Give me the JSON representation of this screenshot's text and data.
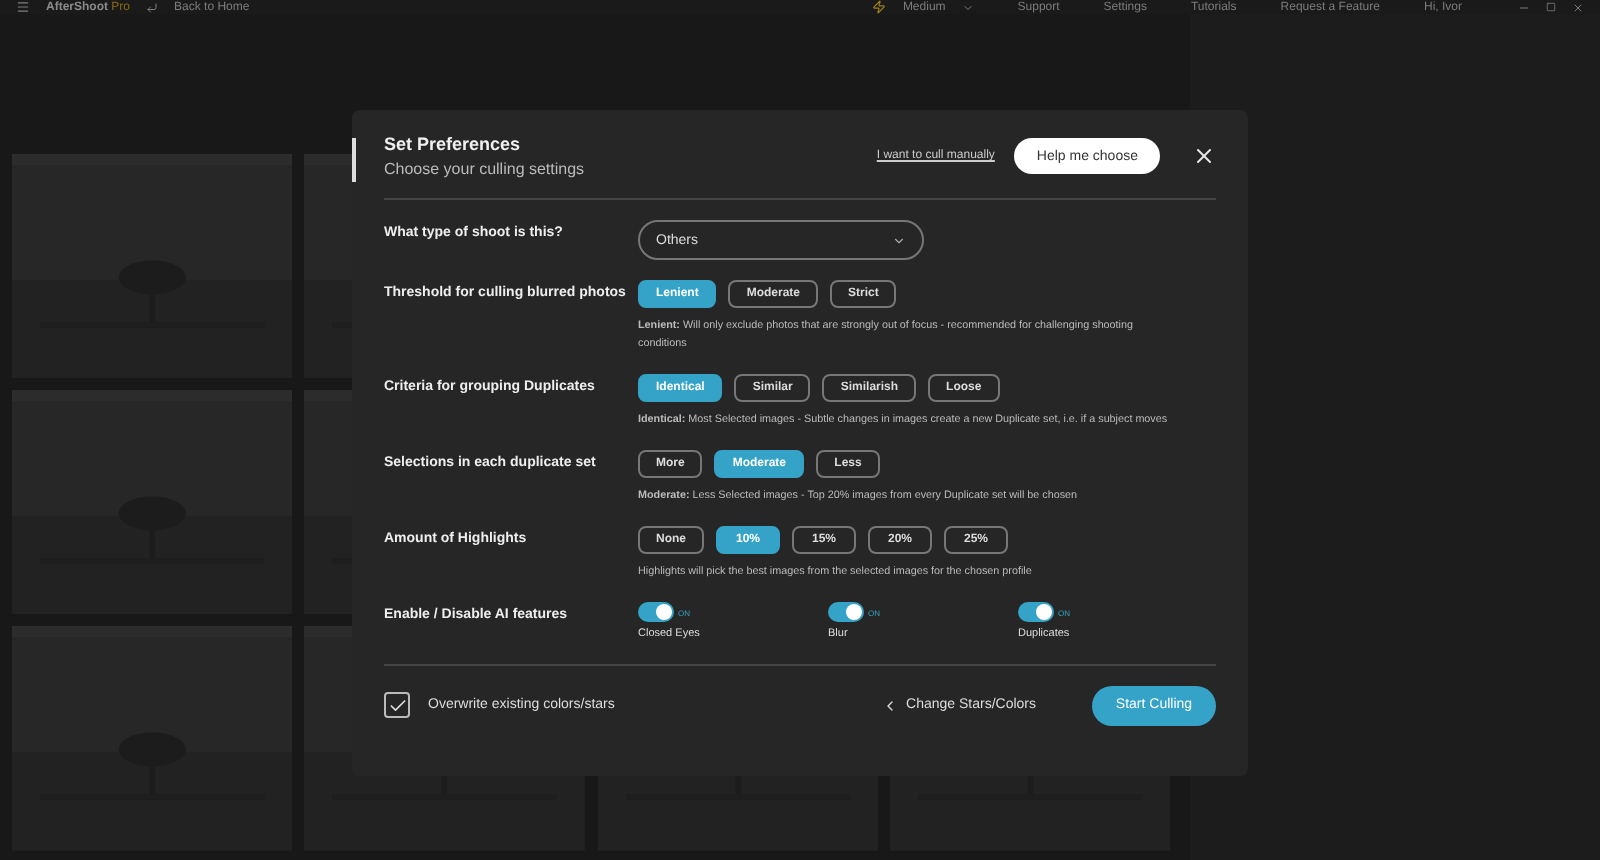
{
  "topbar": {
    "app_name": "AfterShoot",
    "app_suffix": "Pro",
    "back": "Back to Home",
    "speed": "Medium",
    "links": [
      "Support",
      "Settings",
      "Tutorials",
      "Request a Feature"
    ],
    "user": "Hi, Ivor"
  },
  "dialog": {
    "title": "Set Preferences",
    "subtitle": "Choose your culling settings",
    "manual_link": "I want to cull manually",
    "help_button": "Help me choose",
    "rows": [
      {
        "kind": "dropdown",
        "label": "What type of shoot is this?",
        "value": "Others"
      },
      {
        "kind": "options",
        "label": "Threshold for culling blurred photos",
        "options": [
          {
            "label": "Lenient",
            "selected": true
          },
          {
            "label": "Moderate",
            "selected": false
          },
          {
            "label": "Strict",
            "selected": false
          }
        ],
        "note": "**Lenient:** Will only exclude photos that are strongly out of focus - recommended for challenging shooting conditions"
      },
      {
        "kind": "options",
        "label": "Criteria for grouping Duplicates",
        "options": [
          {
            "label": "Identical",
            "selected": true
          },
          {
            "label": "Similar",
            "selected": false
          },
          {
            "label": "Similarish",
            "selected": false
          },
          {
            "label": "Loose",
            "selected": false
          }
        ],
        "note": "**Identical:** Most Selected images - Subtle changes in images create a new Duplicate set, i.e. if a subject moves"
      },
      {
        "kind": "options",
        "label": "Selections in each duplicate set",
        "options": [
          {
            "label": "More",
            "selected": false
          },
          {
            "label": "Moderate",
            "selected": true
          },
          {
            "label": "Less",
            "selected": false
          }
        ],
        "note": "**Moderate:** Less Selected images - Top 20% images from every Duplicate set will be chosen"
      },
      {
        "kind": "options",
        "label": "Amount of Highlights",
        "options": [
          {
            "label": "None",
            "selected": false
          },
          {
            "label": "10%",
            "selected": true
          },
          {
            "label": "15%",
            "selected": false
          },
          {
            "label": "20%",
            "selected": false
          },
          {
            "label": "25%",
            "selected": false
          }
        ],
        "note": "Highlights will pick the best images from the selected images for the chosen profile"
      },
      {
        "kind": "toggles",
        "label": "Enable / Disable AI features",
        "toggles": [
          {
            "label": "Closed Eyes",
            "on": true,
            "state_text": "ON"
          },
          {
            "label": "Blur",
            "on": true,
            "state_text": "ON"
          },
          {
            "label": "Duplicates",
            "on": true,
            "state_text": "ON"
          }
        ]
      }
    ],
    "overwrite": {
      "label": "Overwrite existing colors/stars",
      "checked": true
    },
    "back_link": "Change Stars/Colors",
    "start_button": "Start Culling"
  }
}
